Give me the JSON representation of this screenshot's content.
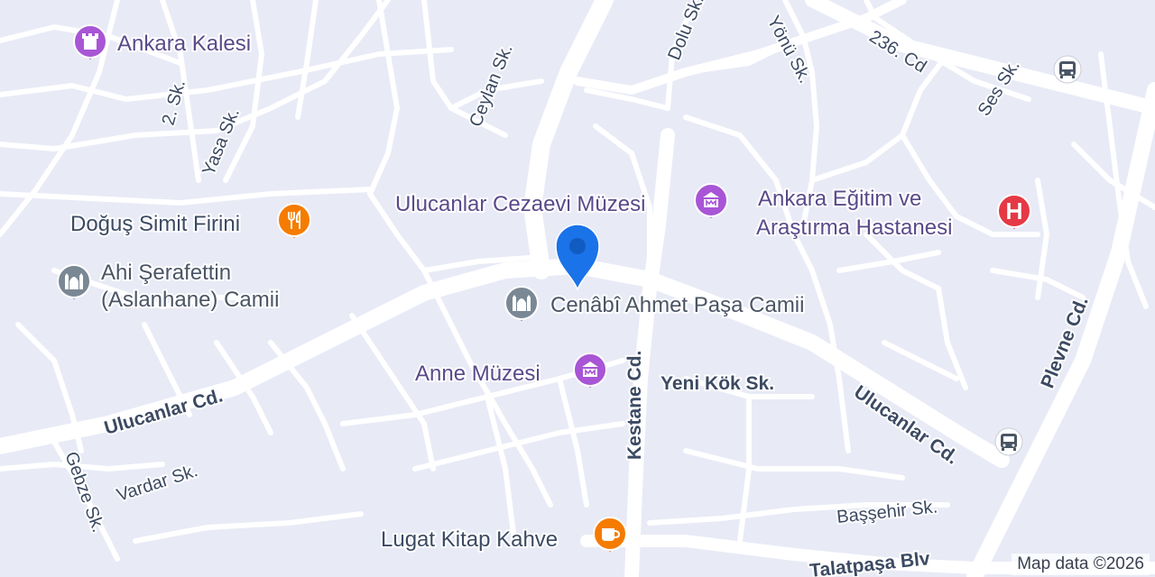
{
  "colors": {
    "land": "#e8eaf6",
    "road": "#ffffff",
    "road_minor": "#fbfbfe",
    "poi_purple": "#a855d6",
    "poi_orange": "#f57c00",
    "poi_gray": "#7a8794",
    "poi_red": "#e53945",
    "pin_blue": "#1a73e8",
    "text_purple": "#5a4a8a",
    "text_gray": "#4a5565",
    "text_orange": "#3c4a63",
    "transit": "#4a5565"
  },
  "pois": {
    "ankara_kalesi": {
      "name": "Ankara Kalesi",
      "icon": "castle-icon"
    },
    "dogus_simit": {
      "name": "Doğuş Simit Firini",
      "icon": "restaurant-icon"
    },
    "ahi_serafettin": {
      "line1": "Ahi Şerafettin",
      "line2": "(Aslanhane) Camii",
      "icon": "mosque-icon"
    },
    "ulucanlar_muzesi": {
      "name": "Ulucanlar Cezaevi Müzesi",
      "icon": "museum-icon"
    },
    "hastane": {
      "line1": "Ankara Eğitim ve",
      "line2": "Araştırma Hastanesi",
      "icon": "hospital-icon"
    },
    "cenabi": {
      "name": "Cenâbî Ahmet Paşa Camii",
      "icon": "mosque-icon"
    },
    "anne_muzesi": {
      "name": "Anne Müzesi",
      "icon": "museum-icon"
    },
    "lugat": {
      "name": "Lugat Kitap Kahve",
      "icon": "cafe-icon"
    }
  },
  "streets": {
    "ceylan": "Ceylan Sk.",
    "dolu": "Dolu Sk.",
    "yonu": "Yönü Sk.",
    "s236": "236. Cd",
    "ses": "Ses Sk.",
    "s2": "2. Sk.",
    "yasa": "Yasa Sk.",
    "ulucanlar_w": "Ulucanlar Cd.",
    "ulucanlar_e": "Ulucanlar Cd.",
    "kestane": "Kestane Cd.",
    "yeni_kok": "Yeni Kök Sk.",
    "plevne": "Plevne Cd.",
    "gebze": "Gebze Sk.",
    "vardar": "Vardar Sk.",
    "bassehir": "Başşehir Sk.",
    "talatpasa": "Talatpaşa Blv"
  },
  "attribution": "Map data ©2026"
}
